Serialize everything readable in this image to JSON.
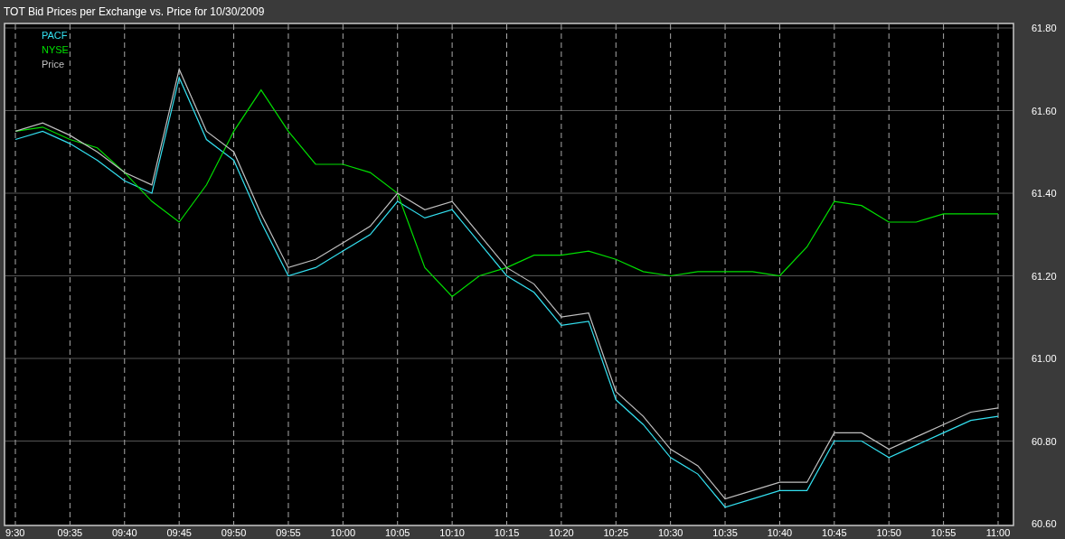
{
  "window": {
    "title": "TOT Bid Prices per Exchange vs. Price for 10/30/2009"
  },
  "chart": {
    "chart_data": {
      "type": "line",
      "grid": true,
      "ylim": [
        60.6,
        61.8
      ],
      "categories": [
        "9:30",
        null,
        "09:35",
        null,
        "09:40",
        null,
        "09:45",
        null,
        "09:50",
        null,
        "09:55",
        null,
        "10:00",
        null,
        "10:05",
        null,
        "10:10",
        null,
        "10:15",
        null,
        "10:20",
        null,
        "10:25",
        null,
        "10:30",
        null,
        "10:35",
        null,
        "10:40",
        null,
        "10:45",
        null,
        "10:50",
        null,
        "10:55",
        null,
        "11:00"
      ],
      "yticks": [
        {
          "value": 61.8,
          "label": "61.80"
        },
        {
          "value": 61.6,
          "label": "61.60"
        },
        {
          "value": 61.4,
          "label": "61.40"
        },
        {
          "value": 61.2,
          "label": "61.20"
        },
        {
          "value": 61.0,
          "label": "61.00"
        },
        {
          "value": 60.8,
          "label": "60.80"
        },
        {
          "value": 60.6,
          "label": "60.60"
        }
      ],
      "series": [
        {
          "name": "PACF",
          "color": "#33e0f0",
          "values": [
            61.53,
            61.55,
            61.52,
            61.48,
            61.43,
            61.4,
            61.68,
            61.53,
            61.48,
            61.33,
            61.2,
            61.22,
            61.26,
            61.3,
            61.38,
            61.34,
            61.36,
            61.28,
            61.2,
            61.16,
            61.08,
            61.09,
            60.9,
            60.84,
            60.76,
            60.72,
            60.64,
            60.66,
            60.68,
            60.68,
            60.8,
            60.8,
            60.76,
            60.79,
            60.82,
            60.85,
            60.86
          ]
        },
        {
          "name": "NYSE",
          "color": "#00e000",
          "values": [
            61.55,
            61.56,
            61.53,
            61.51,
            61.45,
            61.38,
            61.33,
            61.42,
            61.55,
            61.65,
            61.55,
            61.47,
            61.47,
            61.45,
            61.4,
            61.22,
            61.15,
            61.2,
            61.22,
            61.25,
            61.25,
            61.26,
            61.24,
            61.21,
            61.2,
            61.21,
            61.21,
            61.21,
            61.2,
            61.27,
            61.38,
            61.37,
            61.33,
            61.33,
            61.35,
            61.35,
            61.35
          ]
        },
        {
          "name": "Price",
          "color": "#c0c0c0",
          "values": [
            61.55,
            61.57,
            61.54,
            61.5,
            61.45,
            61.42,
            61.7,
            61.55,
            61.5,
            61.35,
            61.22,
            61.24,
            61.28,
            61.32,
            61.4,
            61.36,
            61.38,
            61.3,
            61.22,
            61.18,
            61.1,
            61.11,
            60.92,
            60.86,
            60.78,
            60.74,
            60.66,
            60.68,
            60.7,
            60.7,
            60.82,
            60.82,
            60.78,
            60.81,
            60.84,
            60.87,
            60.88
          ]
        }
      ]
    }
  }
}
